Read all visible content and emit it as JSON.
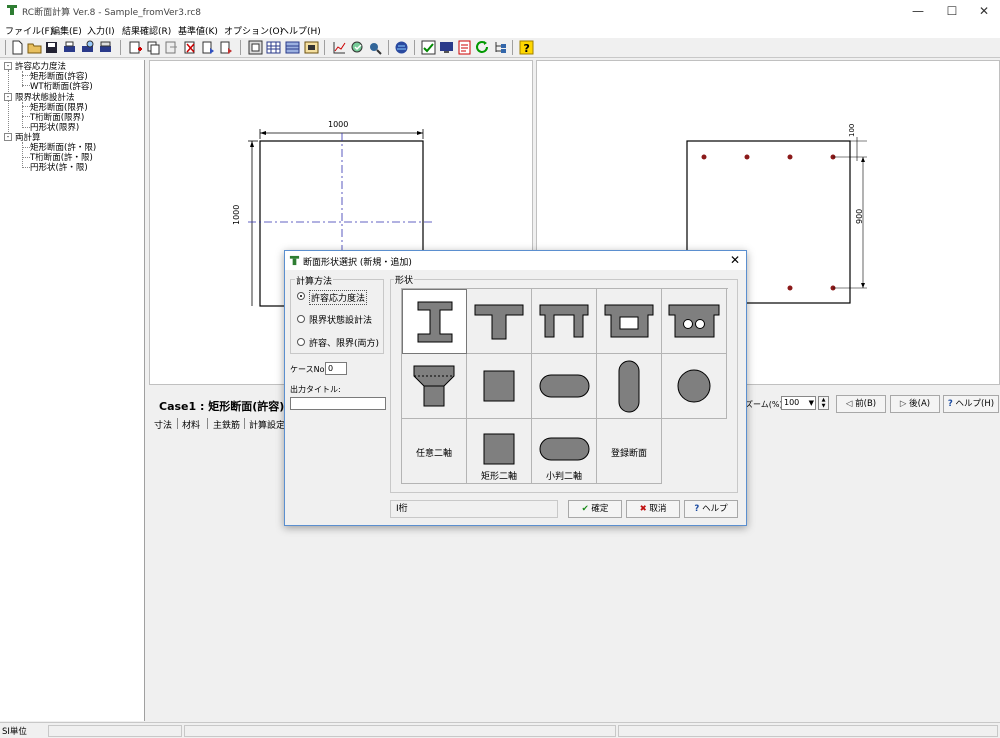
{
  "window": {
    "title": "RC断面計算 Ver.8 - Sample_fromVer3.rc8"
  },
  "menu": [
    "ファイル(F)",
    "編集(E)",
    "入力(I)",
    "結果確認(R)",
    "基準値(K)",
    "オプション(O)",
    "ヘルプ(H)"
  ],
  "tree": {
    "groups": [
      {
        "label": "許容応力度法",
        "children": [
          "矩形断面(許容)",
          "WT桁断面(許容)"
        ]
      },
      {
        "label": "限界状態設計法",
        "children": [
          "矩形断面(限界)",
          "T桁断面(限界)",
          "円形状(限界)"
        ]
      },
      {
        "label": "両計算",
        "children": [
          "矩形断面(許・限)",
          "T桁断面(許・限)",
          "円形状(許・限)"
        ]
      }
    ]
  },
  "drawing_left": {
    "width_label": "1000",
    "height_label": "1000"
  },
  "drawing_right": {
    "cover_label": "100",
    "spacing_label": "900"
  },
  "lower": {
    "case_title": "Case1 : 矩形断面(許容)",
    "tabs": [
      "寸法",
      "材料",
      "主鉄筋",
      "計算設定"
    ],
    "zoom_label": "ズーム(%)",
    "zoom_value": "100",
    "prev_label": "前(B)",
    "next_label": "後(A)",
    "help_label": "ヘルプ(H)"
  },
  "dialog": {
    "title": "断面形状選択 (新規・追加)",
    "calc_method_label": "計算方法",
    "methods": [
      "許容応力度法",
      "限界状態設計法",
      "許容、限界(両方)"
    ],
    "selected_method": "許容応力度法",
    "case_no_label": "ケースNo:",
    "case_no_value": "0",
    "output_title_label": "出力タイトル:",
    "output_title_value": "",
    "shape_label": "形状",
    "shape_text_cells": [
      "任意二軸",
      "矩形二軸",
      "小判二軸",
      "登録断面"
    ],
    "status_text": "I桁",
    "ok_label": "確定",
    "cancel_label": "取消",
    "help_label": "ヘルプ"
  },
  "statusbar": {
    "unit": "SI単位"
  },
  "colors": {
    "shape_fill": "#7f7f7f",
    "rebar": "#8b1a1a",
    "centerline": "#3030b0",
    "dialog_border": "#5b8fcf"
  }
}
